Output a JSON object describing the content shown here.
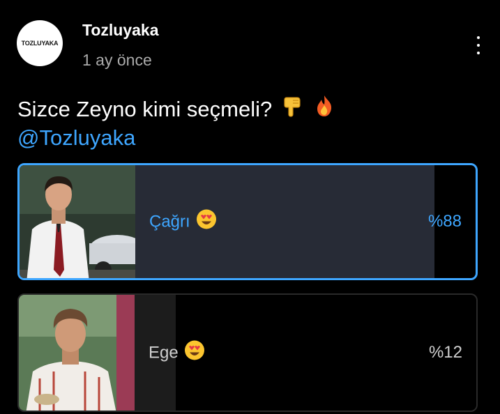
{
  "channel": {
    "avatar_text": "TOZLUYAKA",
    "name": "Tozluyaka",
    "time": "1 ay önce"
  },
  "post": {
    "question": "Sizce Zeyno kimi seçmeli?",
    "emojis": [
      "backhand-index-down-icon",
      "fire-icon"
    ],
    "mention": "@Tozluyaka"
  },
  "poll": {
    "options": [
      {
        "label": "Çağrı",
        "emoji": "smiling-face-heart-eyes-icon",
        "percent_text": "%88",
        "percent": 88,
        "selected": true
      },
      {
        "label": "Ege",
        "emoji": "smiling-face-heart-eyes-icon",
        "percent_text": "%12",
        "percent": 12,
        "selected": false
      }
    ]
  },
  "colors": {
    "accent": "#3ea6ff",
    "background": "#000000",
    "selected_bar": "#272b36",
    "unselected_bar": "#1c1c1c"
  }
}
